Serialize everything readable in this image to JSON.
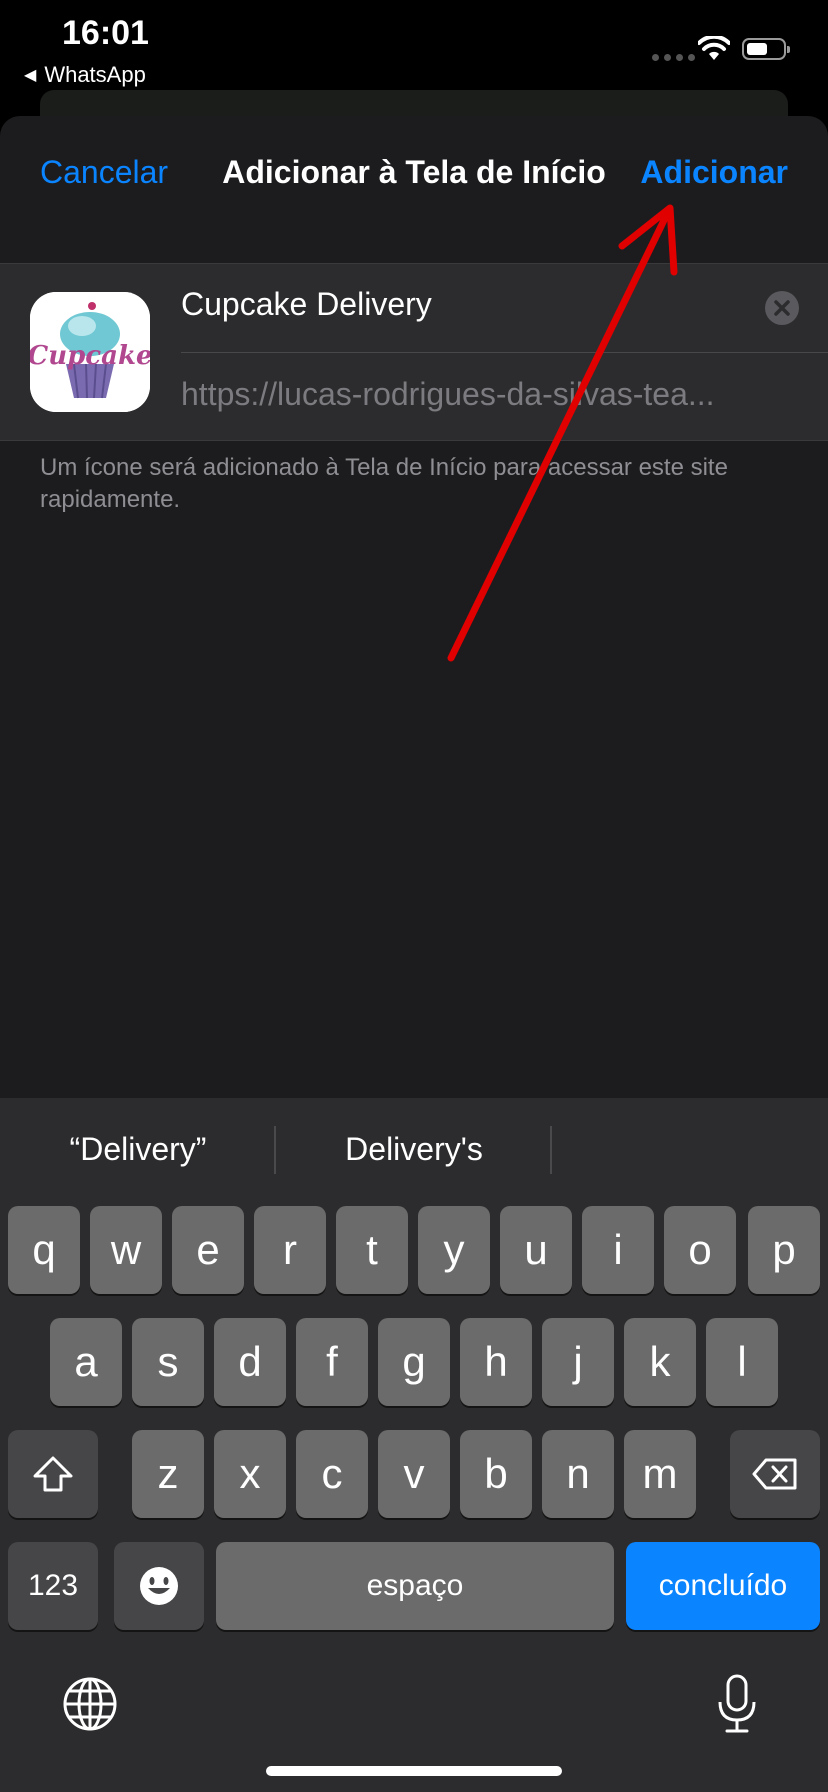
{
  "status_bar": {
    "time": "16:01",
    "back_app": "WhatsApp",
    "back_arrow_glyph": "◀"
  },
  "nav": {
    "cancel": "Cancelar",
    "title": "Adicionar à Tela de Início",
    "add": "Adicionar"
  },
  "form": {
    "app_icon_text": "Cupcake",
    "name_value": "Cupcake Delivery",
    "url_value": "https://lucas-rodrigues-da-silvas-tea..."
  },
  "help_text": "Um ícone será adicionado à Tela de Início para acessar este site rapidamente.",
  "keyboard": {
    "suggestions": [
      "“Delivery”",
      "Delivery's"
    ],
    "row1": [
      "q",
      "w",
      "e",
      "r",
      "t",
      "y",
      "u",
      "i",
      "o",
      "p"
    ],
    "row2": [
      "a",
      "s",
      "d",
      "f",
      "g",
      "h",
      "j",
      "k",
      "l"
    ],
    "row3": [
      "z",
      "x",
      "c",
      "v",
      "b",
      "n",
      "m"
    ],
    "numbers_key": "123",
    "space_key": "espaço",
    "done_key": "concluído"
  },
  "colors": {
    "accent": "#0a84ff",
    "sheet_bg": "#1c1c1e",
    "annotation_arrow": "#e00000"
  },
  "icons": [
    "wifi-icon",
    "battery-icon",
    "clear-icon",
    "shift-icon",
    "backspace-icon",
    "emoji-icon",
    "globe-icon",
    "microphone-icon"
  ]
}
